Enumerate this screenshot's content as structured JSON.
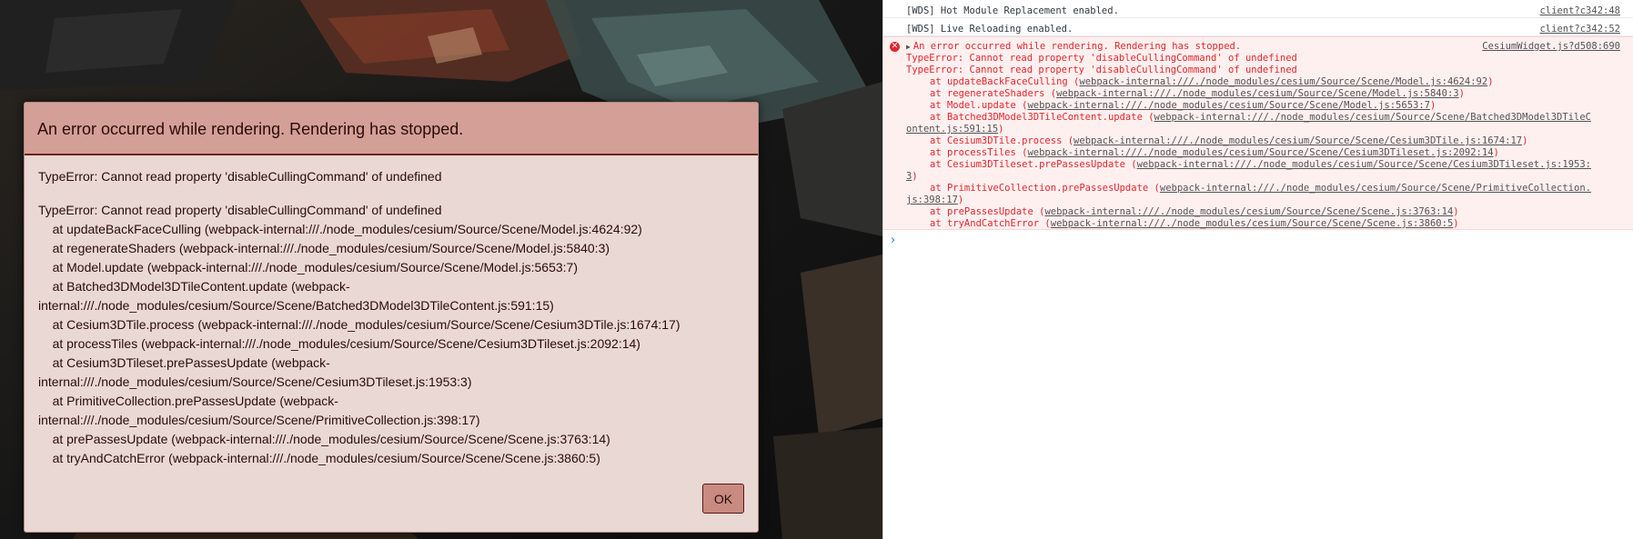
{
  "dialog": {
    "title": "An error occurred while rendering. Rendering has stopped.",
    "message": "TypeError: Cannot read property 'disableCullingCommand' of undefined",
    "trace": [
      "TypeError: Cannot read property 'disableCullingCommand' of undefined",
      "    at updateBackFaceCulling (webpack-internal:///./node_modules/cesium/Source/Scene/Model.js:4624:92)",
      "    at regenerateShaders (webpack-internal:///./node_modules/cesium/Source/Scene/Model.js:5840:3)",
      "    at Model.update (webpack-internal:///./node_modules/cesium/Source/Scene/Model.js:5653:7)",
      "    at Batched3DModel3DTileContent.update (webpack-",
      "internal:///./node_modules/cesium/Source/Scene/Batched3DModel3DTileContent.js:591:15)",
      "    at Cesium3DTile.process (webpack-internal:///./node_modules/cesium/Source/Scene/Cesium3DTile.js:1674:17)",
      "    at processTiles (webpack-internal:///./node_modules/cesium/Source/Scene/Cesium3DTileset.js:2092:14)",
      "    at Cesium3DTileset.prePassesUpdate (webpack-",
      "internal:///./node_modules/cesium/Source/Scene/Cesium3DTileset.js:1953:3)",
      "    at PrimitiveCollection.prePassesUpdate (webpack-",
      "internal:///./node_modules/cesium/Source/Scene/PrimitiveCollection.js:398:17)",
      "    at prePassesUpdate (webpack-internal:///./node_modules/cesium/Source/Scene/Scene.js:3763:14)",
      "    at tryAndCatchError (webpack-internal:///./node_modules/cesium/Source/Scene/Scene.js:3860:5)"
    ],
    "ok_label": "OK"
  },
  "console": {
    "logs": [
      {
        "text": "[WDS] Hot Module Replacement enabled.",
        "source": "client?c342:48"
      },
      {
        "text": "[WDS] Live Reloading enabled.",
        "source": "client?c342:52"
      }
    ],
    "error": {
      "icon": "error-circle-icon",
      "caret": "▶",
      "head": "An error occurred while rendering.  Rendering has stopped.",
      "source": "CesiumWidget.js?d508:690",
      "lines": [
        "TypeError: Cannot read property 'disableCullingCommand' of undefined",
        "TypeError: Cannot read property 'disableCullingCommand' of undefined"
      ],
      "stack": [
        {
          "fn": "at updateBackFaceCulling (",
          "link": "webpack-internal:///./node_modules/cesium/Source/Scene/Model.js:4624:92",
          "end": ")"
        },
        {
          "fn": "at regenerateShaders (",
          "link": "webpack-internal:///./node_modules/cesium/Source/Scene/Model.js:5840:3",
          "end": ")"
        },
        {
          "fn": "at Model.update (",
          "link": "webpack-internal:///./node_modules/cesium/Source/Scene/Model.js:5653:7",
          "end": ")"
        },
        {
          "fn": "at Batched3DModel3DTileContent.update (",
          "link": "webpack-internal:///./node_modules/cesium/Source/Scene/Batched3DModel3DTileC",
          "end": "",
          "cont": "ontent.js:591:15",
          "cont_end": ")"
        },
        {
          "fn": "at Cesium3DTile.process (",
          "link": "webpack-internal:///./node_modules/cesium/Source/Scene/Cesium3DTile.js:1674:17",
          "end": ")"
        },
        {
          "fn": "at processTiles (",
          "link": "webpack-internal:///./node_modules/cesium/Source/Scene/Cesium3DTileset.js:2092:14",
          "end": ")"
        },
        {
          "fn": "at Cesium3DTileset.prePassesUpdate (",
          "link": "webpack-internal:///./node_modules/cesium/Source/Scene/Cesium3DTileset.js:1953:",
          "end": "",
          "cont": "3",
          "cont_end": ")"
        },
        {
          "fn": "at PrimitiveCollection.prePassesUpdate (",
          "link": "webpack-internal:///./node_modules/cesium/Source/Scene/PrimitiveCollection.",
          "end": "",
          "cont": "js:398:17",
          "cont_end": ")"
        },
        {
          "fn": "at prePassesUpdate (",
          "link": "webpack-internal:///./node_modules/cesium/Source/Scene/Scene.js:3763:14",
          "end": ")"
        },
        {
          "fn": "at tryAndCatchError (",
          "link": "webpack-internal:///./node_modules/cesium/Source/Scene/Scene.js:3860:5",
          "end": ")"
        }
      ]
    },
    "prompt": "›"
  }
}
